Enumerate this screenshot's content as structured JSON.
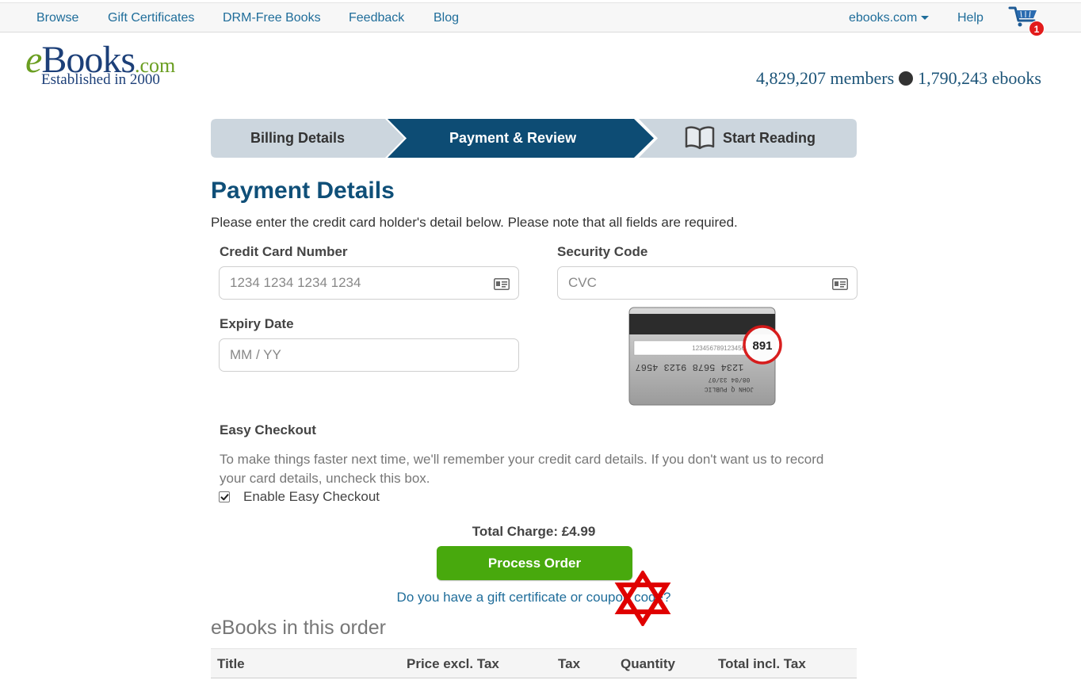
{
  "topnav": {
    "links": [
      "Browse",
      "Gift Certificates",
      "DRM-Free Books",
      "Feedback",
      "Blog"
    ],
    "site_dropdown": "ebooks.com",
    "help": "Help",
    "cart_count": "1"
  },
  "logo": {
    "e": "e",
    "books": "Books",
    "com": ".com",
    "tagline": "Established in 2000"
  },
  "stats": {
    "members": "4,829,207 members",
    "ebooks": "1,790,243 ebooks"
  },
  "steps": [
    {
      "label": "Billing Details",
      "state": "done"
    },
    {
      "label": "Payment & Review",
      "state": "active"
    },
    {
      "label": "Start Reading",
      "state": "upcoming"
    }
  ],
  "payment": {
    "title": "Payment Details",
    "intro": "Please enter the credit card holder's detail below. Please note that all fields are required.",
    "card_number_label": "Credit Card Number",
    "card_number_placeholder": "1234 1234 1234 1234",
    "security_code_label": "Security Code",
    "security_code_placeholder": "CVC",
    "expiry_label": "Expiry Date",
    "expiry_placeholder": "MM / YY"
  },
  "cvc_illustration": {
    "number_strip": "123456789123456",
    "cvc": "891",
    "card_number": "1234 5678 9123 4567",
    "dates": "08/04   33/07",
    "holder": "JOHN Q PUBLIC"
  },
  "easy_checkout": {
    "title": "Easy Checkout",
    "text": "To make things faster next time, we'll remember your credit card details. If you don't want us to record your card details, uncheck this box.",
    "checkbox_label": "Enable Easy Checkout",
    "checked": true
  },
  "order": {
    "total": "Total Charge: £4.99",
    "process_button": "Process Order",
    "coupon_link": "Do you have a gift certificate or coupon code?",
    "books_title": "eBooks in this order",
    "columns": [
      "Title",
      "Price excl. Tax",
      "Tax",
      "Quantity",
      "Total incl. Tax"
    ]
  },
  "colors": {
    "link": "#1f6d9a",
    "active_step": "#0d4c74",
    "inactive_step": "#ccd6de",
    "process_button": "#48a90d",
    "badge": "#e21b1b",
    "annotation_star": "#e00000"
  }
}
